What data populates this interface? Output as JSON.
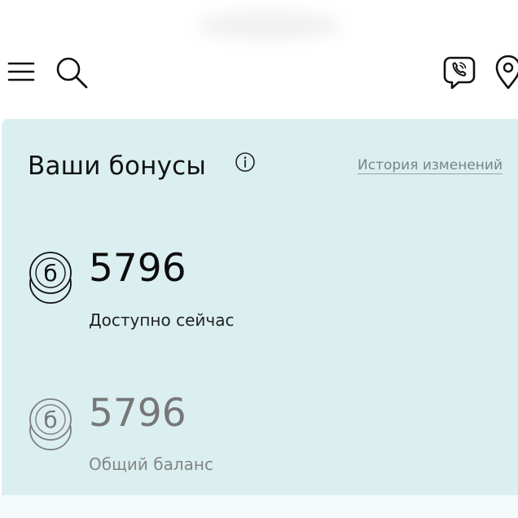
{
  "header": {
    "menu_icon": "hamburger-menu-icon",
    "search_icon": "search-icon",
    "viber_icon": "viber-icon",
    "location_icon": "location-pin-icon"
  },
  "bonuses": {
    "title": "Ваши бонусы",
    "info_icon": "info-icon",
    "history_link": "История изменений",
    "available": {
      "amount": "5796",
      "label": "Доступно сейчас",
      "coin_letter": "б"
    },
    "total": {
      "amount": "5796",
      "label": "Общий баланс",
      "coin_letter": "б"
    }
  },
  "colors": {
    "card_background": "#dbeff0",
    "primary_text": "#111111",
    "secondary_text": "#7a8484",
    "muted_amount": "#777777"
  }
}
